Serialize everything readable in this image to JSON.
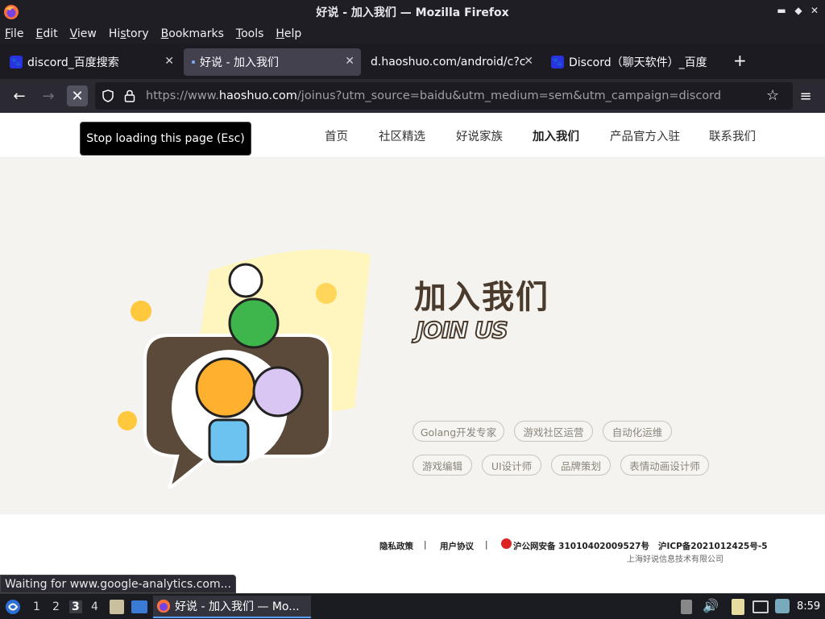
{
  "window": {
    "title": "好说 - 加入我们 — Mozilla Firefox"
  },
  "menu": [
    {
      "label": "File",
      "key": "F"
    },
    {
      "label": "Edit",
      "key": "E"
    },
    {
      "label": "View",
      "key": "V"
    },
    {
      "label": "History",
      "key": "s"
    },
    {
      "label": "Bookmarks",
      "key": "B"
    },
    {
      "label": "Tools",
      "key": "T"
    },
    {
      "label": "Help",
      "key": "H"
    }
  ],
  "tabs": [
    {
      "label": "discord_百度搜索"
    },
    {
      "label": "好说 - 加入我们"
    },
    {
      "label": "d.haoshuo.com/android/c?c"
    },
    {
      "label": "Discord（聊天软件）_百度"
    }
  ],
  "url": {
    "prefix": "https://www.",
    "domain": "haoshuo.com",
    "path": "/joinus?utm_source=baidu&utm_medium=sem&utm_campaign=discord"
  },
  "tooltip": "Stop loading this page (Esc)",
  "site_nav": [
    "首页",
    "社区精选",
    "好说家族",
    "加入我们",
    "产品官方入驻",
    "联系我们"
  ],
  "hero": {
    "title": "加入我们",
    "subtitle": "JOIN US",
    "tags_row1": [
      "Golang开发专家",
      "游戏社区运营",
      "自动化运维"
    ],
    "tags_row2": [
      "游戏编辑",
      "UI设计师",
      "品牌策划",
      "表情动画设计师"
    ]
  },
  "footer": {
    "privacy": "隐私政策",
    "agreement": "用户协议",
    "police": "沪公网安备 31010402009527号",
    "icp": "沪ICP备2021012425号-5",
    "company": "上海好说信息技术有限公司"
  },
  "status_text": "Waiting for www.google-analytics.com...",
  "taskbar": {
    "workspaces": [
      "1",
      "2",
      "3",
      "4"
    ],
    "active_task": "好说 - 加入我们 — Mo...",
    "clock": "8:59"
  },
  "colors": {
    "accent": "#5aa0ff",
    "hero_bg": "#f5f3ef",
    "brand_brown": "#4a3b2c"
  }
}
